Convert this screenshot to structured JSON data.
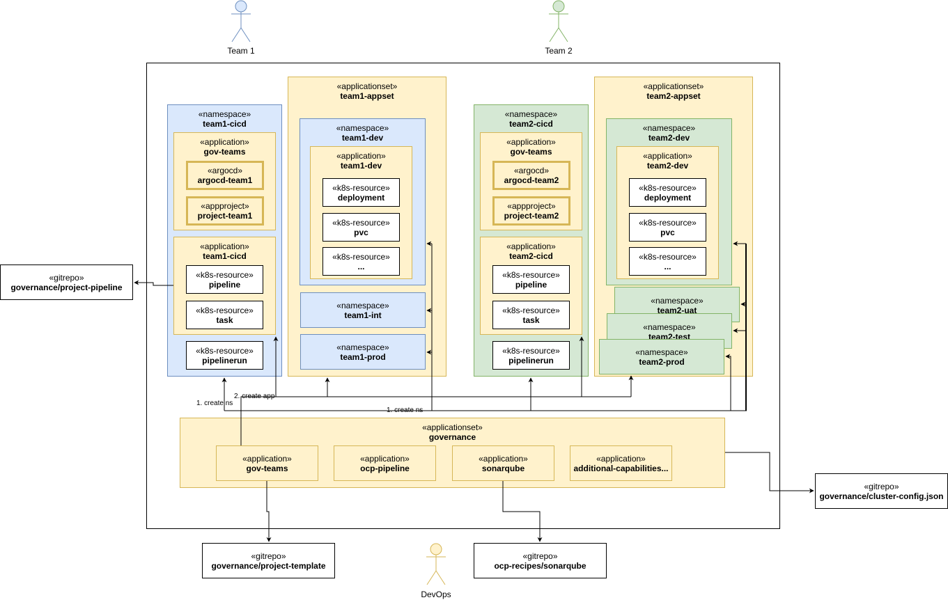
{
  "actors": {
    "team1": {
      "label": "Team 1",
      "color": "#6c8ebf",
      "fill": "#dae8fc"
    },
    "team2": {
      "label": "Team 2",
      "color": "#82b366",
      "fill": "#d5e8d4"
    },
    "devops": {
      "label": "DevOps",
      "color": "#d6b656",
      "fill": "#fff2cc"
    }
  },
  "team1": {
    "cicd_ns": {
      "stereotype": "«namespace»",
      "name": "team1-cicd"
    },
    "gov_teams_app": {
      "stereotype": "«application»",
      "name": "gov-teams"
    },
    "argocd": {
      "stereotype": "«argocd»",
      "name": "argocd-team1"
    },
    "appproject": {
      "stereotype": "«appproject»",
      "name": "project-team1"
    },
    "cicd_app": {
      "stereotype": "«application»",
      "name": "team1-cicd"
    },
    "pipeline": {
      "stereotype": "«k8s-resource»",
      "name": "pipeline"
    },
    "task": {
      "stereotype": "«k8s-resource»",
      "name": "task"
    },
    "pipelinerun": {
      "stereotype": "«k8s-resource»",
      "name": "pipelinerun"
    },
    "appset": {
      "stereotype": "«applicationset»",
      "name": "team1-appset"
    },
    "dev_ns": {
      "stereotype": "«namespace»",
      "name": "team1-dev"
    },
    "dev_app": {
      "stereotype": "«application»",
      "name": "team1-dev"
    },
    "deployment": {
      "stereotype": "«k8s-resource»",
      "name": "deployment"
    },
    "pvc": {
      "stereotype": "«k8s-resource»",
      "name": "pvc"
    },
    "more": {
      "stereotype": "«k8s-resource»",
      "name": "..."
    },
    "int_ns": {
      "stereotype": "«namespace»",
      "name": "team1-int"
    },
    "prod_ns": {
      "stereotype": "«namespace»",
      "name": "team1-prod"
    }
  },
  "team2": {
    "cicd_ns": {
      "stereotype": "«namespace»",
      "name": "team2-cicd"
    },
    "gov_teams_app": {
      "stereotype": "«application»",
      "name": "gov-teams"
    },
    "argocd": {
      "stereotype": "«argocd»",
      "name": "argocd-team2"
    },
    "appproject": {
      "stereotype": "«appproject»",
      "name": "project-team2"
    },
    "cicd_app": {
      "stereotype": "«application»",
      "name": "team2-cicd"
    },
    "pipeline": {
      "stereotype": "«k8s-resource»",
      "name": "pipeline"
    },
    "task": {
      "stereotype": "«k8s-resource»",
      "name": "task"
    },
    "pipelinerun": {
      "stereotype": "«k8s-resource»",
      "name": "pipelinerun"
    },
    "appset": {
      "stereotype": "«applicationset»",
      "name": "team2-appset"
    },
    "dev_ns": {
      "stereotype": "«namespace»",
      "name": "team2-dev"
    },
    "dev_app": {
      "stereotype": "«application»",
      "name": "team2-dev"
    },
    "deployment": {
      "stereotype": "«k8s-resource»",
      "name": "deployment"
    },
    "pvc": {
      "stereotype": "«k8s-resource»",
      "name": "pvc"
    },
    "more": {
      "stereotype": "«k8s-resource»",
      "name": "..."
    },
    "uat_ns": {
      "stereotype": "«namespace»",
      "name": "team2-uat"
    },
    "test_ns": {
      "stereotype": "«namespace»",
      "name": "team2-test"
    },
    "prod_ns": {
      "stereotype": "«namespace»",
      "name": "team2-prod"
    }
  },
  "governance": {
    "appset": {
      "stereotype": "«applicationset»",
      "name": "governance"
    },
    "apps": [
      {
        "stereotype": "«application»",
        "name": "gov-teams"
      },
      {
        "stereotype": "«application»",
        "name": "ocp-pipeline"
      },
      {
        "stereotype": "«application»",
        "name": "sonarqube"
      },
      {
        "stereotype": "«application»",
        "name": "additional-capabilities..."
      }
    ]
  },
  "repos": {
    "project_pipeline": {
      "stereotype": "«gitrepo»",
      "name": "governance/project-pipeline"
    },
    "cluster_config": {
      "stereotype": "«gitrepo»",
      "name": "governance/cluster-config.json"
    },
    "project_template": {
      "stereotype": "«gitrepo»",
      "name": "governance/project-template"
    },
    "sonarqube": {
      "stereotype": "«gitrepo»",
      "name": "ocp-recipes/sonarqube"
    }
  },
  "edge_labels": {
    "create_app": "2. create app",
    "create_ns_left": "1. create ns",
    "create_ns_mid": "1. create ns"
  }
}
